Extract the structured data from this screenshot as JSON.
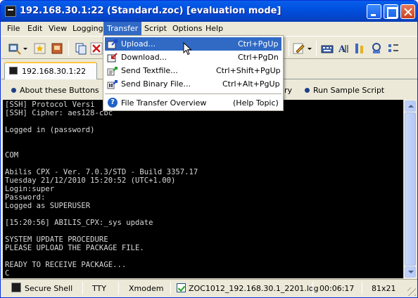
{
  "window": {
    "title": "192.168.30.1:22 (Standard.zoc) [evaluation mode]"
  },
  "menubar": {
    "items": [
      "File",
      "Edit",
      "View",
      "Logging",
      "Transfer",
      "Script",
      "Options",
      "Help"
    ],
    "active": "Transfer"
  },
  "tabs": [
    {
      "label": "192.168.30.1:22"
    }
  ],
  "quickbar": {
    "left": "About these Buttons",
    "partial": "ry",
    "right": "Run Sample Script"
  },
  "transfer_menu": {
    "items": [
      {
        "label": "Upload...",
        "shortcut": "Ctrl+PgUp",
        "icon": "upload-icon",
        "highlighted": true
      },
      {
        "label": "Download...",
        "shortcut": "Ctrl+PgDn",
        "icon": "download-icon"
      },
      {
        "label": "Send Textfile...",
        "shortcut": "Ctrl+Shift+PgUp",
        "icon": "send-textfile-icon"
      },
      {
        "label": "Send Binary File...",
        "shortcut": "Ctrl+Alt+PgUp",
        "icon": "send-binary-icon"
      },
      {
        "label": "File Transfer Overview",
        "shortcut": "(Help Topic)",
        "icon": "help-icon"
      }
    ]
  },
  "terminal": {
    "lines": [
      "[SSH] Protocol Versi",
      "[SSH] Cipher: aes128-cbc",
      "",
      "Logged in (password)",
      "",
      "",
      "COM",
      "",
      "Abilis CPX - Ver. 7.0.3/STD - Build 3357.17",
      "Tuesday 21/12/2010 15:20:52 (UTC+1.00)",
      "Login:super",
      "Password:",
      "Logged as SUPERUSER",
      "",
      "[15:20:56] ABILIS_CPX:_sys update",
      "",
      "SYSTEM UPDATE PROCEDURE",
      "PLEASE UPLOAD THE PACKAGE FILE.",
      "",
      "READY TO RECEIVE PACKAGE...",
      "C"
    ]
  },
  "statusbar": {
    "connection": "Secure Shell",
    "emulation": "TTY",
    "transfer": "Xmodem",
    "logfile": "ZOC1012_192.168.30.1_2201.log",
    "elapsed": "00:06:17",
    "size": "81x21"
  },
  "colors": {
    "accent": "#316ac5",
    "titlebar": "#0054e3",
    "terminal_bg": "#000000",
    "terminal_fg": "#d8d8d8"
  }
}
